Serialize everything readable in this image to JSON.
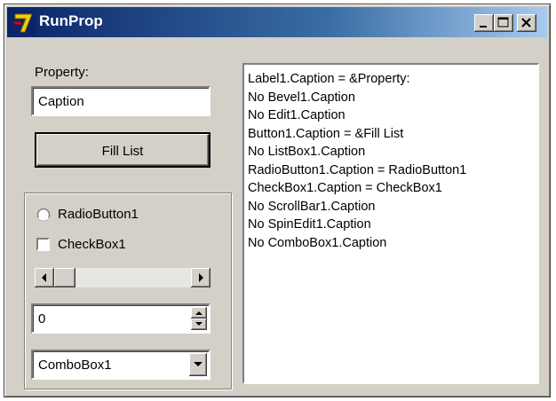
{
  "window": {
    "title": "RunProp"
  },
  "property_label": "Property:",
  "property_input": {
    "value": "Caption"
  },
  "fill_button": {
    "label": "Fill List"
  },
  "group": {
    "radio_label": "RadioButton1",
    "checkbox_label": "CheckBox1",
    "spin_value": "0",
    "combo_value": "ComboBox1"
  },
  "list_items": [
    "Label1.Caption = &Property:",
    "No Bevel1.Caption",
    "No Edit1.Caption",
    "Button1.Caption = &Fill List",
    "No ListBox1.Caption",
    "RadioButton1.Caption = RadioButton1",
    "CheckBox1.Caption = CheckBox1",
    "No ScrollBar1.Caption",
    "No SpinEdit1.Caption",
    "No ComboBox1.Caption"
  ],
  "icons": {
    "app": "delphi-app-icon",
    "minimize": "minimize-icon",
    "maximize": "maximize-icon",
    "close": "close-icon"
  },
  "colors": {
    "face": "#d4d0c8",
    "title_start": "#0a246a",
    "title_end": "#a6caf0"
  }
}
